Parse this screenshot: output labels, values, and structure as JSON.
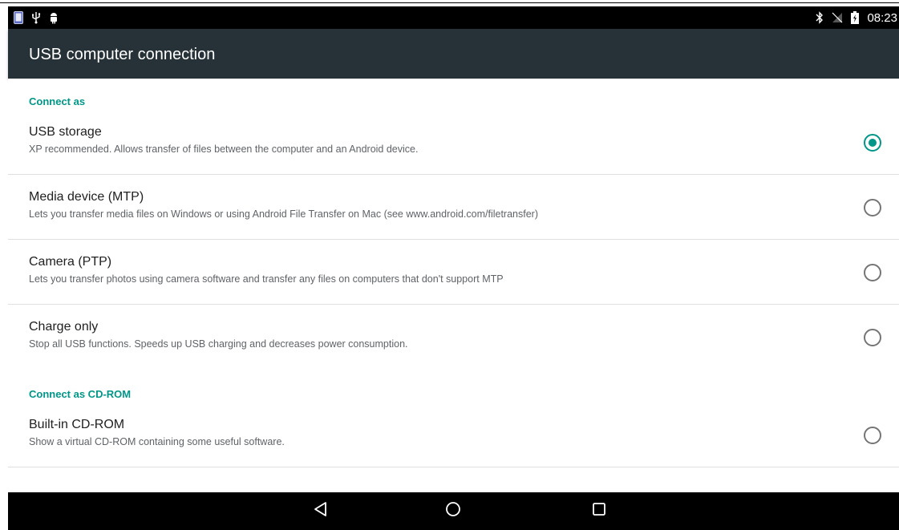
{
  "status_bar": {
    "left_icons": [
      "tablet-icon",
      "usb-icon",
      "android-debug-icon"
    ],
    "right_icons": [
      "bluetooth-icon",
      "no-signal-icon",
      "battery-charging-icon"
    ],
    "time": "08:23"
  },
  "app_bar": {
    "title": "USB computer connection"
  },
  "sections": [
    {
      "header": "Connect as",
      "items": [
        {
          "title": "USB storage",
          "summary": "XP recommended. Allows transfer of files between the computer and an Android device.",
          "checked": true
        },
        {
          "title": "Media device (MTP)",
          "summary": "Lets you transfer media files on Windows or using Android File Transfer on Mac (see www.android.com/filetransfer)",
          "checked": false
        },
        {
          "title": "Camera (PTP)",
          "summary": "Lets you transfer photos using camera software and transfer any files on computers that don't support MTP",
          "checked": false
        },
        {
          "title": "Charge only",
          "summary": "Stop all USB functions. Speeds up USB charging and decreases power consumption.",
          "checked": false
        }
      ]
    },
    {
      "header": "Connect as CD-ROM",
      "items": [
        {
          "title": "Built-in CD-ROM",
          "summary": "Show a virtual CD-ROM containing some useful software.",
          "checked": false
        }
      ]
    }
  ],
  "nav_bar": {
    "buttons": [
      "back-icon",
      "home-icon",
      "recents-icon"
    ]
  },
  "colors": {
    "accent": "#009688",
    "app_bar": "#263238",
    "status_bar": "#000000"
  }
}
